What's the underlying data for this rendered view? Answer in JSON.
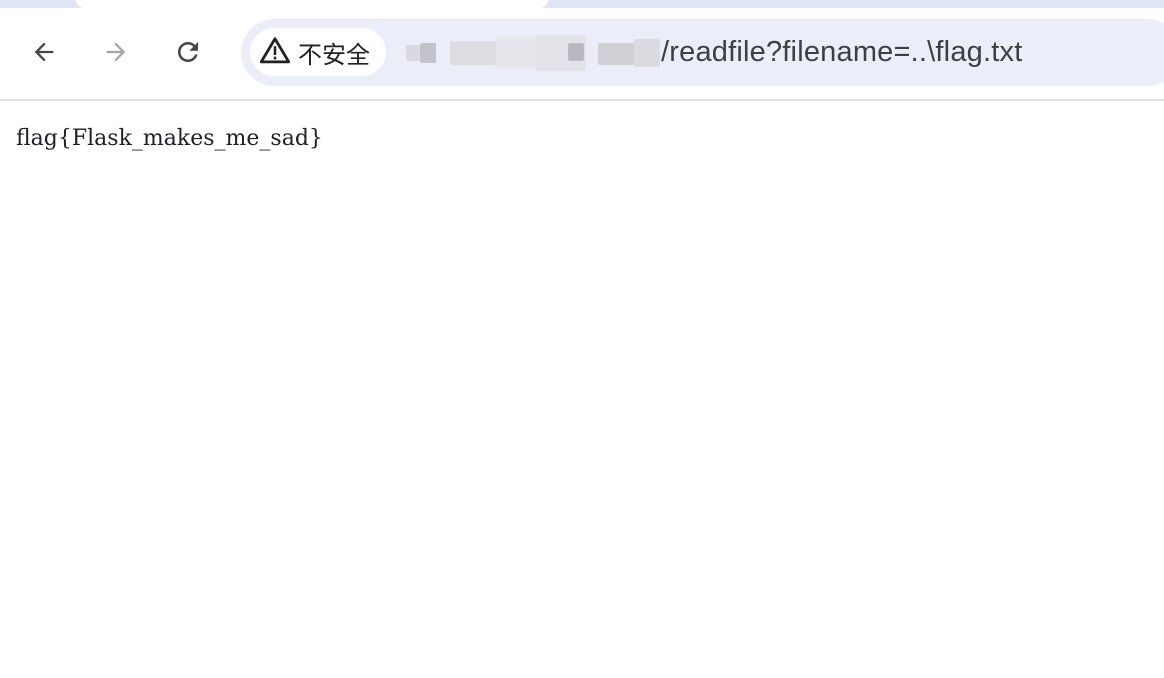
{
  "browser": {
    "nav": {
      "back_icon": "arrow-left-icon",
      "forward_icon": "arrow-right-icon",
      "reload_icon": "reload-icon"
    },
    "omnibox": {
      "security_icon": "warning-triangle-icon",
      "security_label": "不安全",
      "url_path": "/readfile?filename=..\\flag.txt"
    },
    "colors": {
      "omnibox_bg": "#ebeef8",
      "tabstrip_bg": "#dfe6f5",
      "forward_disabled": "#a6a6a6",
      "icon_active": "#444746"
    }
  },
  "page": {
    "body_text": "flag{Flask_makes_me_sad}"
  }
}
